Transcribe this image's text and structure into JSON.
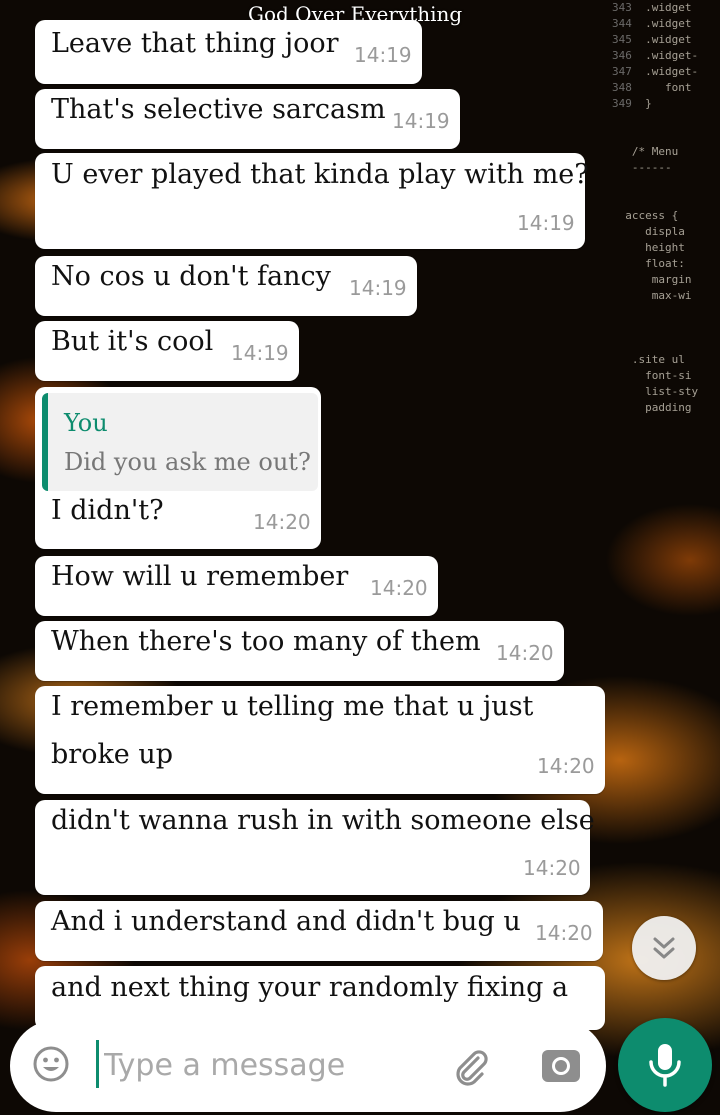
{
  "chat": {
    "title": "God Over Everything"
  },
  "messages": [
    {
      "text": "Leave that thing joor",
      "time": "14:19"
    },
    {
      "text": "That's selective sarcasm",
      "time": "14:19"
    },
    {
      "text": "U ever played that kinda play with me?",
      "time": "14:19"
    },
    {
      "text": "No cos u don't fancy",
      "time": "14:19"
    },
    {
      "text": "But it's cool",
      "time": "14:19"
    },
    {
      "text": "I didn't?",
      "time": "14:20",
      "quote": {
        "author": "You",
        "text": "Did you ask me out?"
      }
    },
    {
      "text": "How will u remember",
      "time": "14:20"
    },
    {
      "text": "When there's too many of them",
      "time": "14:20"
    },
    {
      "text_line1": "I remember u telling me that u just",
      "text_line2": "broke up",
      "time": "14:20"
    },
    {
      "text": "didn't wanna rush in with someone else",
      "time": "14:20"
    },
    {
      "text": "And i understand and didn't bug u",
      "time": "14:20"
    },
    {
      "text": "and next thing your randomly fixing a"
    }
  ],
  "composer": {
    "placeholder": "Type a message"
  },
  "icons": {
    "emoji": "emoji-icon",
    "attach": "paperclip-icon",
    "camera": "camera-icon",
    "mic": "microphone-icon",
    "scroll": "double-chevron-down-icon"
  },
  "colors": {
    "accent": "#0d8c6e",
    "bubble": "#ffffff",
    "timestamp": "#9a9a9a"
  }
}
